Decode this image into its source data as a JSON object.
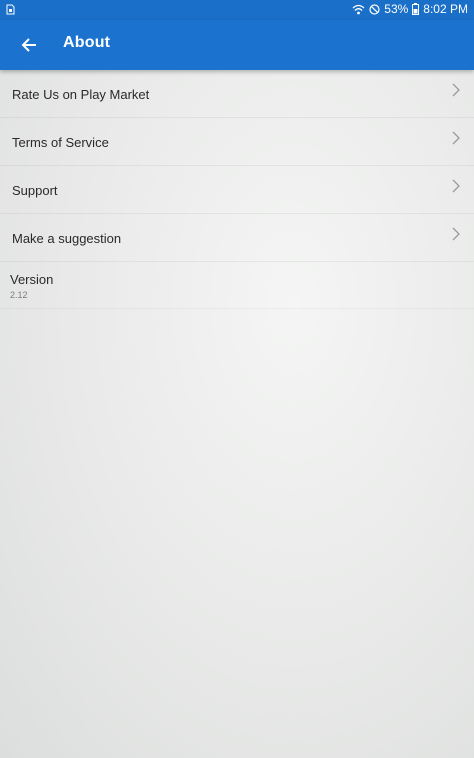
{
  "status_bar": {
    "battery": "53%",
    "time": "8:02 PM",
    "icons": [
      "sim-icon",
      "wifi-icon",
      "do-not-disturb-icon",
      "battery-icon"
    ]
  },
  "app_bar": {
    "title": "About",
    "back_icon": "arrow-back-icon",
    "color": "#1b73cf"
  },
  "menu": {
    "items": [
      {
        "label": "Rate Us on Play Market"
      },
      {
        "label": "Terms of Service"
      },
      {
        "label": "Support"
      },
      {
        "label": "Make a suggestion"
      }
    ],
    "chevron_icon": "chevron-right-icon"
  },
  "version": {
    "label": "Version",
    "value": "2.12"
  }
}
